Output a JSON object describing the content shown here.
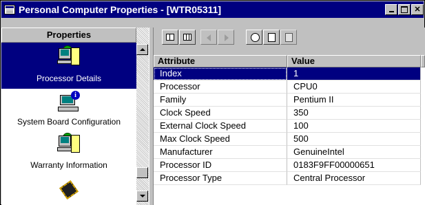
{
  "window": {
    "title": "Personal Computer Properties - [WTR05311]",
    "controls": [
      "minimize",
      "maximize",
      "close"
    ]
  },
  "left_panel": {
    "header": "Properties",
    "items": [
      {
        "label": "Processor Details",
        "icon": "processor-computer-icon",
        "selected": true
      },
      {
        "label": "System Board Configuration",
        "icon": "system-board-info-icon",
        "selected": false
      },
      {
        "label": "Warranty Information",
        "icon": "warranty-computer-icon",
        "selected": false
      },
      {
        "label": "",
        "icon": "memory-chip-icon",
        "selected": false
      }
    ]
  },
  "toolbar": {
    "buttons": [
      {
        "icon": "grid-view-icon",
        "enabled": true
      },
      {
        "icon": "table-view-icon",
        "enabled": true
      },
      {
        "icon": "previous-arrow-icon",
        "enabled": false
      },
      {
        "icon": "next-arrow-icon",
        "enabled": false
      },
      {
        "icon": "history-clock-icon",
        "enabled": true
      },
      {
        "icon": "page-refresh-icon",
        "enabled": true
      },
      {
        "icon": "properties-icon",
        "enabled": false
      }
    ]
  },
  "table": {
    "columns": [
      "Attribute",
      "Value"
    ],
    "rows": [
      {
        "attribute": "Index",
        "value": "1",
        "selected": true
      },
      {
        "attribute": "Processor",
        "value": "CPU0"
      },
      {
        "attribute": "Family",
        "value": "Pentium II"
      },
      {
        "attribute": "Clock Speed",
        "value": "350"
      },
      {
        "attribute": "External Clock Speed",
        "value": "100"
      },
      {
        "attribute": "Max Clock Speed",
        "value": "500"
      },
      {
        "attribute": "Manufacturer",
        "value": "GenuineIntel"
      },
      {
        "attribute": "Processor ID",
        "value": "0183F9FF00000651"
      },
      {
        "attribute": "Processor Type",
        "value": "Central Processor"
      }
    ]
  },
  "colors": {
    "title_bar": "#000080",
    "selection": "#000080",
    "face": "#c0c0c0"
  }
}
